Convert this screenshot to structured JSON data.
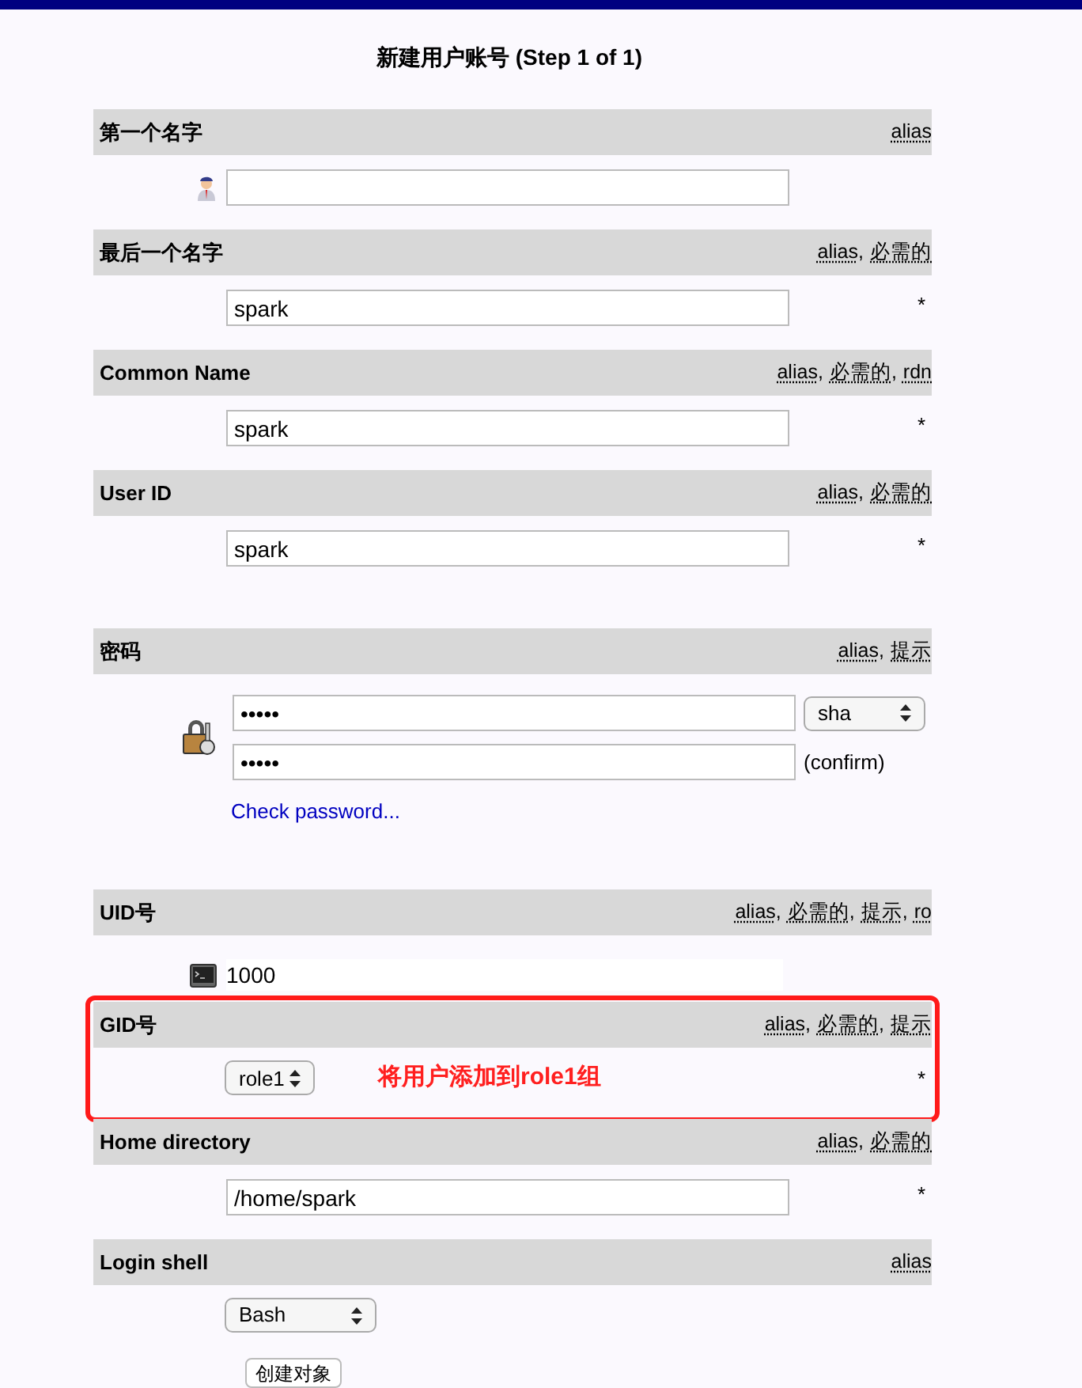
{
  "page_title": "新建用户账号 (Step 1 of 1)",
  "tag_separator": ",",
  "sections": [
    {
      "kind": "avatar-text",
      "title": "第一个名字",
      "tags": [
        "alias"
      ]
    },
    {
      "kind": "text",
      "title": "最后一个名字",
      "tags": [
        "alias",
        "必需的"
      ],
      "value": "spark",
      "required": true
    },
    {
      "kind": "text",
      "title": "Common Name",
      "tags": [
        "alias",
        "必需的",
        "rdn"
      ],
      "value": "spark",
      "required": true
    },
    {
      "kind": "text",
      "title": "User ID",
      "tags": [
        "alias",
        "必需的"
      ],
      "value": "spark",
      "required": true
    },
    {
      "kind": "password",
      "title": "密码",
      "tags": [
        "alias",
        "提示"
      ],
      "value": "•••••",
      "confirm_value": "•••••",
      "hash": "sha",
      "confirm_label": "(confirm)",
      "link": "Check password..."
    },
    {
      "kind": "uid",
      "title": "UID号",
      "tags": [
        "alias",
        "必需的",
        "提示",
        "ro"
      ],
      "value": "1000"
    },
    {
      "kind": "select",
      "title": "GID号",
      "tags": [
        "alias",
        "必需的",
        "提示"
      ],
      "value": "role1",
      "required": true,
      "highlight": {
        "note": "将用户添加到role1组"
      }
    },
    {
      "kind": "text",
      "title": "Home directory",
      "tags": [
        "alias",
        "必需的"
      ],
      "value": "/home/spark",
      "required": true
    },
    {
      "kind": "select",
      "title": "Login shell",
      "tags": [
        "alias"
      ],
      "value": "Bash",
      "wide": true
    }
  ],
  "required_mark": "*",
  "submit": "创建对象"
}
